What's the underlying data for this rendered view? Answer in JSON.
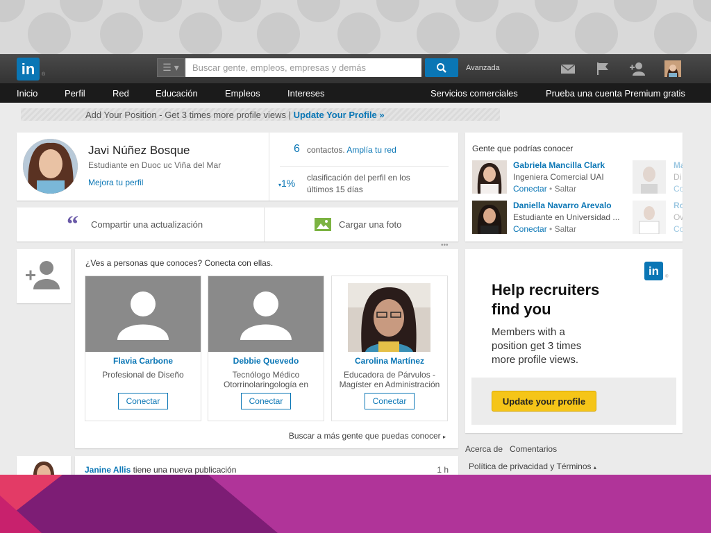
{
  "header": {
    "logo": "in",
    "search": {
      "placeholder": "Buscar gente, empleos, empresas y demás"
    },
    "advanced": "Avanzada"
  },
  "nav": {
    "items": [
      "Inicio",
      "Perfil",
      "Red",
      "Educación",
      "Empleos",
      "Intereses",
      "Servicios comerciales",
      "Prueba una cuenta Premium gratis"
    ]
  },
  "banner": {
    "text": "Add Your Position - Get 3 times more profile views |",
    "link": "Update Your Profile »"
  },
  "profile": {
    "name": "Javi Núñez Bosque",
    "headline": "Estudiante en Duoc uc Viña del Mar",
    "improve": "Mejora tu perfil",
    "contacts_count": "6",
    "contacts_label": "contactos.",
    "contacts_link": "Amplía tu red",
    "rank_change": "1%",
    "rank_text": "clasificación del perfil en los últimos 15 días"
  },
  "share": {
    "update": "Compartir una actualización",
    "photo": "Cargar una foto"
  },
  "connect": {
    "title": "¿Ves a personas que conoces? Conecta con ellas.",
    "people": [
      {
        "name": "Flavia Carbone",
        "line1": "Profesional de Diseño",
        "line2": "",
        "button": "Conectar"
      },
      {
        "name": "Debbie Quevedo",
        "line1": "Tecnólogo Médico",
        "line2": "Otorrinolaringología en",
        "button": "Conectar"
      },
      {
        "name": "Carolina Martínez",
        "line1": "Educadora de Párvulos -",
        "line2": "Magíster en Administración",
        "button": "Conectar"
      }
    ],
    "more": "Buscar a más gente que puedas conocer"
  },
  "feed": {
    "author": "Janine Allis",
    "action": "tiene una nueva publicación",
    "time": "1 h"
  },
  "pymk": {
    "title": "Gente que podrías conocer",
    "people": [
      {
        "name": "Gabriela Mancilla Clark",
        "headline": "Ingeniera Comercial UAI",
        "connect": "Conectar",
        "skip": "Saltar"
      },
      {
        "name": "Daniella Navarro Arevalo",
        "headline": "Estudiante en Universidad ...",
        "connect": "Conectar",
        "skip": "Saltar"
      }
    ],
    "partial": [
      {
        "a": "Ma",
        "b": "Di",
        "c": "Co"
      },
      {
        "a": "Ro",
        "b": "Ow",
        "c": "Co"
      }
    ]
  },
  "ad": {
    "logo": "in",
    "headline": "Help recruiters find you",
    "body": "Members with a position get 3 times more profile views.",
    "button": "Update your profile"
  },
  "footer_links": {
    "about": "Acerca de",
    "comments": "Comentarios",
    "privacy": "Política de privacidad y Términos"
  },
  "colors": {
    "accent": "#0a76b5",
    "cta": "#f5c518",
    "magenta": "#9d2a8c"
  }
}
